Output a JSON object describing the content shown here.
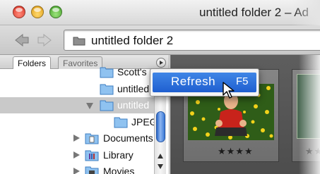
{
  "window": {
    "title": "untitled folder 2 – Ad"
  },
  "toolbar": {
    "back_icon": "back-arrow-icon",
    "forward_icon": "forward-arrow-icon",
    "path_icon": "folder-icon",
    "path_text": "untitled folder 2"
  },
  "panel": {
    "tabs": [
      {
        "label": "Folders",
        "active": true
      },
      {
        "label": "Favorites",
        "active": false
      }
    ],
    "menu_icon": "panel-menu-icon"
  },
  "tree": {
    "items": [
      {
        "label": "Scott's C",
        "icon": "folder-icon",
        "expanded": null
      },
      {
        "label": "untitled",
        "icon": "folder-icon",
        "expanded": null
      },
      {
        "label": "untitled",
        "icon": "folder-icon",
        "expanded": true,
        "selected": true
      },
      {
        "label": "JPEG",
        "icon": "folder-icon",
        "expanded": null
      },
      {
        "label": "Documents",
        "icon": "documents-folder-icon",
        "expanded": false
      },
      {
        "label": "Library",
        "icon": "library-folder-icon",
        "expanded": false
      },
      {
        "label": "Movies",
        "icon": "movies-folder-icon",
        "expanded": false
      }
    ]
  },
  "context_menu": {
    "item_label": "Refresh",
    "shortcut": "F5"
  },
  "content": {
    "thumbnails": [
      {
        "rating": "★★★★",
        "image": "child-in-flower-field-photo"
      },
      {
        "rating": "★★★",
        "image": "partial-thumbnail"
      }
    ]
  },
  "colors": {
    "selection_blue": "#2a6fd8",
    "content_bg": "#555555"
  }
}
